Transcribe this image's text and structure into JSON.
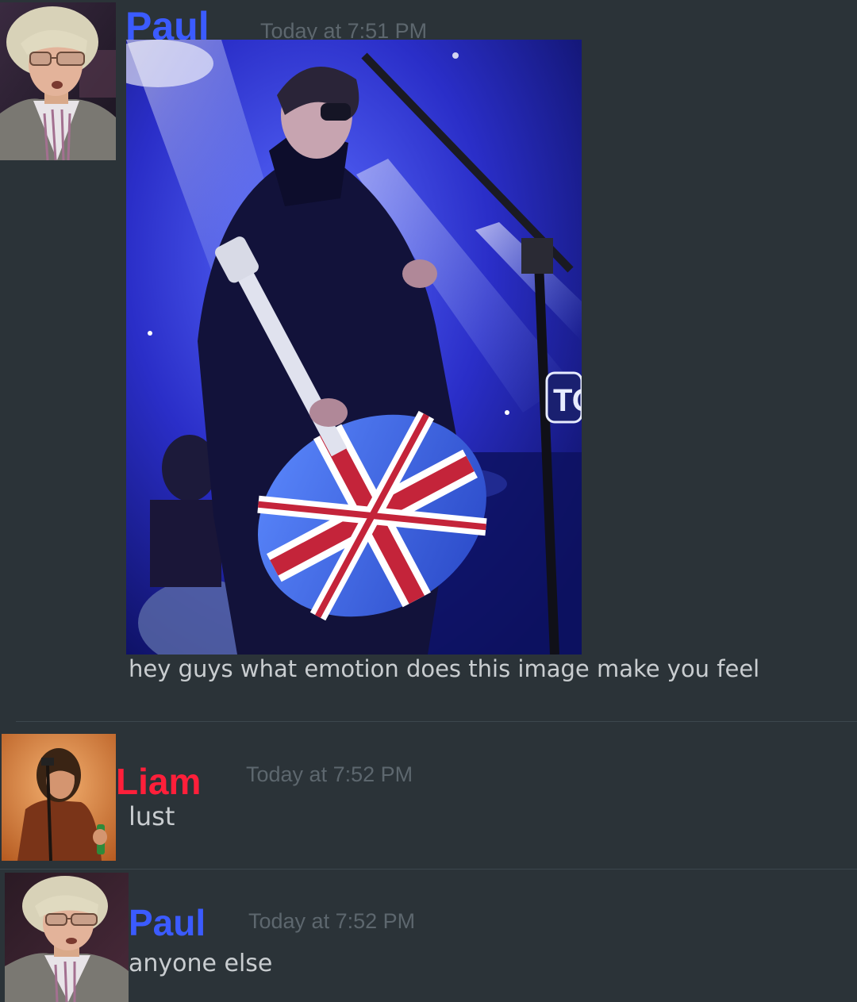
{
  "messages": [
    {
      "username": "Paul",
      "username_color": "#3b5bff",
      "timestamp": "Today at 7:51 PM",
      "text": "hey guys what emotion does this image make you feel",
      "has_image": true
    },
    {
      "username": "Liam",
      "username_color": "#ff1f3a",
      "timestamp": "Today at 7:52 PM",
      "text": "lust"
    },
    {
      "username": "Paul",
      "username_color": "#3b5bff",
      "timestamp": "Today at 7:52 PM",
      "text": "anyone else"
    }
  ],
  "image_text": "TO",
  "colors": {
    "background": "#2b3338",
    "text": "#c9cdd0",
    "timestamp": "#5d676e",
    "divider": "#3c474d"
  }
}
